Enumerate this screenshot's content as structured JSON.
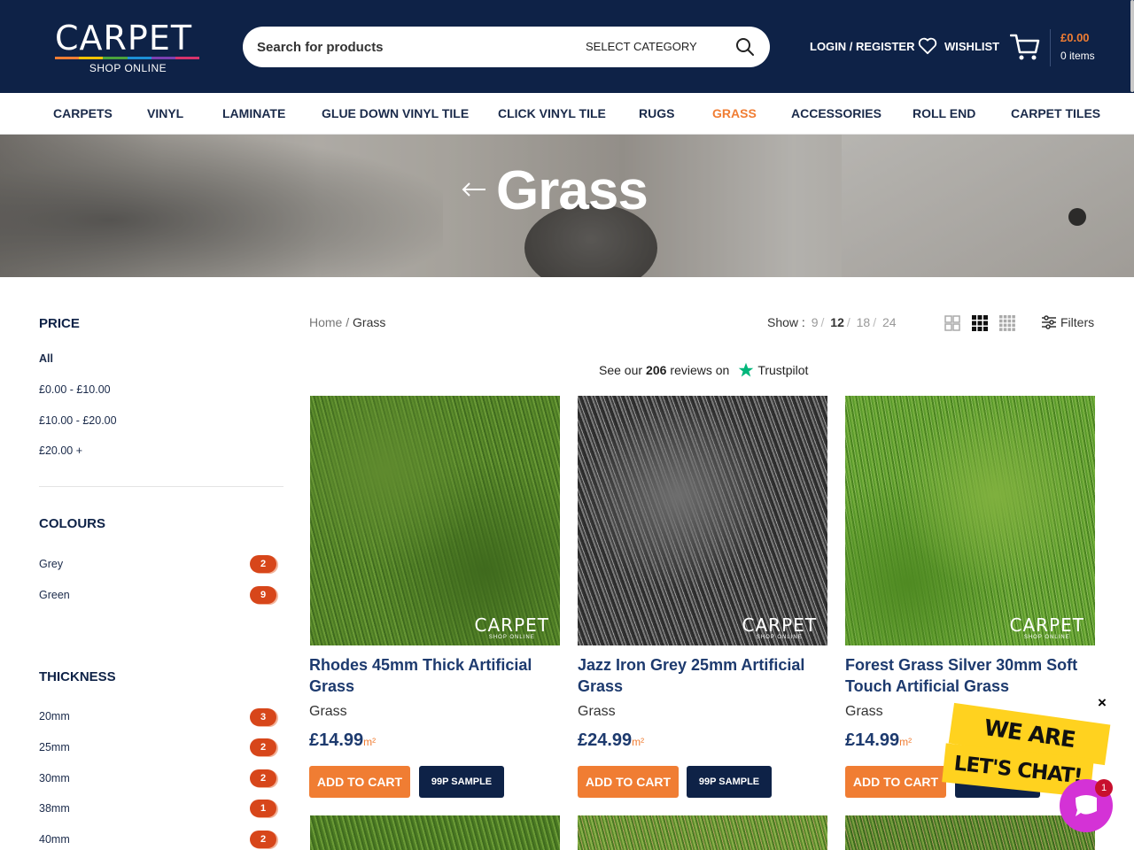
{
  "header": {
    "logo_text": "CARPET",
    "logo_sub": "SHOP ONLINE",
    "logo_colors": [
      "#f07d33",
      "#f2c200",
      "#4aa33c",
      "#1c8fd6",
      "#7b3fb0",
      "#d6336c"
    ],
    "search_placeholder": "Search for products",
    "search_category": "SELECT CATEGORY",
    "login": "LOGIN / REGISTER",
    "wishlist": "WISHLIST",
    "cart_total": "£0.00",
    "cart_items": "0 items",
    "accent_color": "#f07d33",
    "bg_color": "#0e2247"
  },
  "nav": {
    "items": [
      {
        "label": "CARPETS"
      },
      {
        "label": "VINYL"
      },
      {
        "label": "LAMINATE"
      },
      {
        "label": "GLUE DOWN VINYL TILE"
      },
      {
        "label": "CLICK VINYL TILE"
      },
      {
        "label": "RUGS"
      },
      {
        "label": "GRASS"
      },
      {
        "label": "ACCESSORIES"
      },
      {
        "label": "ROLL END"
      },
      {
        "label": "CARPET TILES"
      }
    ],
    "active": "GRASS"
  },
  "hero": {
    "title": "Grass"
  },
  "sidebar": {
    "price": {
      "title": "PRICE",
      "items": [
        "All",
        "£0.00 - £10.00",
        "£10.00 - £20.00",
        "£20.00 +"
      ]
    },
    "colours": {
      "title": "COLOURS",
      "items": [
        {
          "label": "Grey",
          "count": "2"
        },
        {
          "label": "Green",
          "count": "9"
        }
      ]
    },
    "thickness": {
      "title": "THICKNESS",
      "items": [
        {
          "label": "20mm",
          "count": "3"
        },
        {
          "label": "25mm",
          "count": "2"
        },
        {
          "label": "30mm",
          "count": "2"
        },
        {
          "label": "38mm",
          "count": "1"
        },
        {
          "label": "40mm",
          "count": "2"
        }
      ]
    }
  },
  "toolbar": {
    "breadcrumb_home": "Home",
    "breadcrumb_sep": "/",
    "breadcrumb_current": "Grass",
    "show_label": "Show :",
    "show_options": [
      "9",
      "12",
      "18",
      "24"
    ],
    "show_selected": "12",
    "filters": "Filters"
  },
  "trustpilot": {
    "prefix": "See our",
    "count": "206",
    "suffix": "reviews on",
    "brand": "Trustpilot"
  },
  "products": [
    {
      "name": "Rhodes 45mm Thick Artificial Grass",
      "category": "Grass",
      "price": "£14.99",
      "unit": "m²",
      "cart_label": "ADD TO CART",
      "sample_label": "99P SAMPLE"
    },
    {
      "name": "Jazz Iron Grey 25mm Artificial Grass",
      "category": "Grass",
      "price": "£24.99",
      "unit": "m²",
      "cart_label": "ADD TO CART",
      "sample_label": "99P SAMPLE"
    },
    {
      "name": "Forest Grass Silver 30mm Soft Touch Artificial Grass",
      "category": "Grass",
      "price": "£14.99",
      "unit": "m²",
      "cart_label": "ADD TO CART",
      "sample_label": "99P SAMPLE"
    }
  ],
  "chat": {
    "line1": "WE ARE HERE!",
    "line2": "LET'S CHAT!",
    "badge": "1",
    "close": "×"
  }
}
